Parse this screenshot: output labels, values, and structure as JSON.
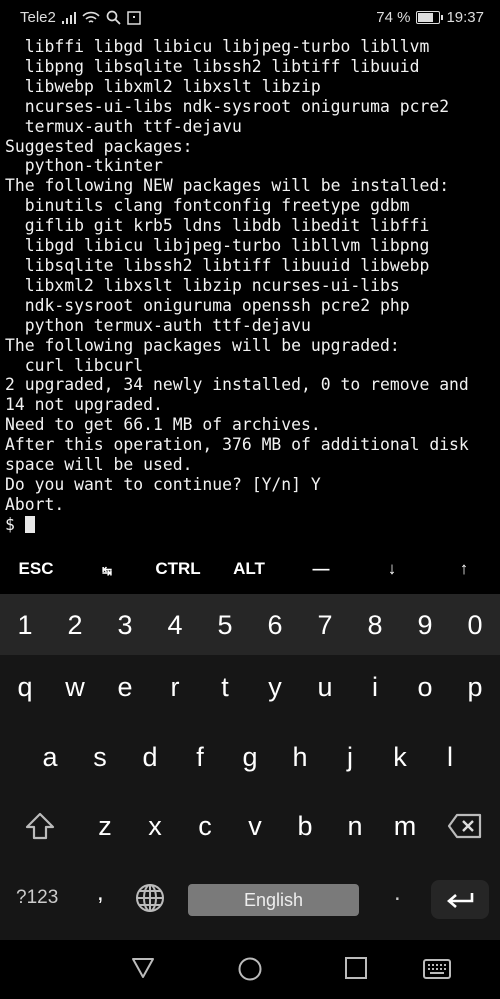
{
  "status_bar": {
    "carrier": "Tele2",
    "battery": "74 %",
    "battery_level": 74,
    "time": "19:37",
    "icons": [
      "signal-icon",
      "wifi-icon",
      "search-icon",
      "notification-icon"
    ]
  },
  "terminal": {
    "lines": [
      "  libffi libgd libicu libjpeg-turbo libllvm",
      "  libpng libsqlite libssh2 libtiff libuuid",
      "  libwebp libxml2 libxslt libzip",
      "  ncurses-ui-libs ndk-sysroot oniguruma pcre2",
      "  termux-auth ttf-dejavu",
      "Suggested packages:",
      "  python-tkinter",
      "The following NEW packages will be installed:",
      "  binutils clang fontconfig freetype gdbm",
      "  giflib git krb5 ldns libdb libedit libffi",
      "  libgd libicu libjpeg-turbo libllvm libpng",
      "  libsqlite libssh2 libtiff libuuid libwebp",
      "  libxml2 libxslt libzip ncurses-ui-libs",
      "  ndk-sysroot oniguruma openssh pcre2 php",
      "  python termux-auth ttf-dejavu",
      "The following packages will be upgraded:",
      "  curl libcurl",
      "2 upgraded, 34 newly installed, 0 to remove and",
      "14 not upgraded.",
      "Need to get 66.1 MB of archives.",
      "After this operation, 376 MB of additional disk",
      "space will be used.",
      "Do you want to continue? [Y/n] Y",
      "Abort."
    ],
    "prompt": "$ "
  },
  "extra_keys": [
    "ESC",
    "↹",
    "CTRL",
    "ALT",
    "—",
    "↓",
    "↑"
  ],
  "keyboard": {
    "numbers": [
      "1",
      "2",
      "3",
      "4",
      "5",
      "6",
      "7",
      "8",
      "9",
      "0"
    ],
    "row1": [
      "q",
      "w",
      "e",
      "r",
      "t",
      "y",
      "u",
      "i",
      "o",
      "p"
    ],
    "row2": [
      "a",
      "s",
      "d",
      "f",
      "g",
      "h",
      "j",
      "k",
      "l"
    ],
    "row3": [
      "z",
      "x",
      "c",
      "v",
      "b",
      "n",
      "m"
    ],
    "symbols_label": "?123",
    "comma": ",",
    "space_label": "English",
    "period": "."
  },
  "colors": {
    "keyboard_bg": "#161616",
    "number_row_bg": "#262626",
    "space_bg": "#7a7a7a",
    "enter_bg": "#262626"
  }
}
